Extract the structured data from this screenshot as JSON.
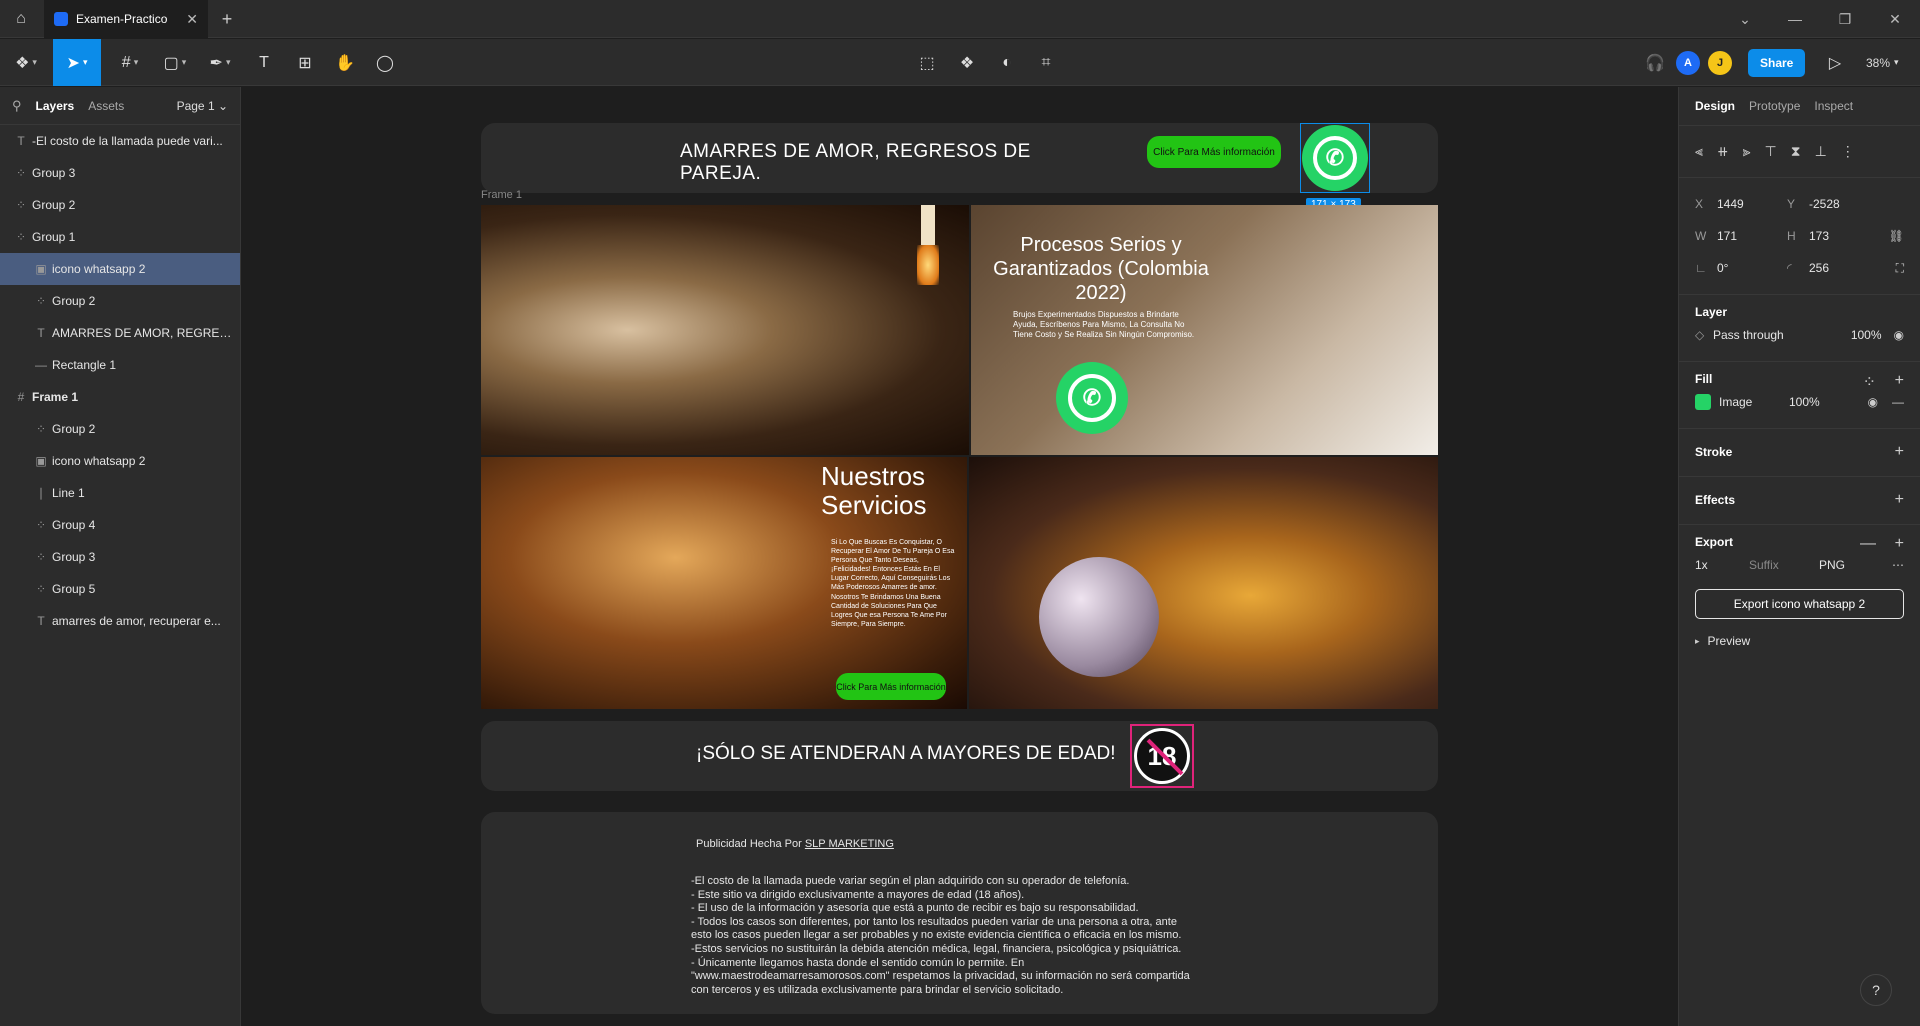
{
  "titlebar": {
    "tab_title": "Examen-Practico",
    "close_glyph": "✕",
    "new_tab_glyph": "+",
    "window_controls": [
      "⌄",
      "—",
      "❐",
      "✕"
    ]
  },
  "toolbar": {
    "avatars": [
      "A",
      "J"
    ],
    "share_label": "Share",
    "zoom": "38%"
  },
  "left_panel": {
    "tabs": {
      "layers": "Layers",
      "assets": "Assets"
    },
    "page": "Page 1 ⌄",
    "layers": [
      {
        "icon": "T",
        "name": "-El costo de la llamada puede vari..."
      },
      {
        "icon": "⁘",
        "name": "Group 3"
      },
      {
        "icon": "⁘",
        "name": "Group 2"
      },
      {
        "icon": "⁘",
        "name": "Group 1"
      },
      {
        "icon": "▣",
        "name": "icono whatsapp 2"
      },
      {
        "icon": "⁘",
        "name": "Group 2"
      },
      {
        "icon": "T",
        "name": "AMARRES DE AMOR, REGRES..."
      },
      {
        "icon": "—",
        "name": "Rectangle 1"
      },
      {
        "icon": "#",
        "name": "Frame 1"
      },
      {
        "icon": "⁘",
        "name": "Group 2"
      },
      {
        "icon": "▣",
        "name": "icono whatsapp 2"
      },
      {
        "icon": "∣",
        "name": "Line 1"
      },
      {
        "icon": "⁘",
        "name": "Group 4"
      },
      {
        "icon": "⁘",
        "name": "Group 3"
      },
      {
        "icon": "⁘",
        "name": "Group 5"
      },
      {
        "icon": "T",
        "name": "amarres de amor, recuperar e..."
      }
    ]
  },
  "canvas": {
    "header_title": "AMARRES DE AMOR, REGRESOS DE PAREJA.",
    "click_button": "Click Para Más información",
    "selection_size": "171 × 173",
    "frame_label": "Frame 1",
    "tile1_title": "Procesos Serios y Garantizados (Colombia 2022)",
    "tile1_text": "Brujos Experimentados Dispuestos a Brindarte Ayuda, Escríbenos Para Mismo, La Consulta No Tiene Costo y Se Realiza Sin Ningún Compromiso.",
    "tile3_title": "Nuestros Servicios",
    "tile3_text": "Si Lo Que Buscas Es Conquistar, O Recuperar El Amor De Tu Pareja O Esa Persona Que Tanto Deseas, ¡Felicidades! Entonces Estás En El Lugar Correcto, Aquí Conseguirás Los Más Poderosos Amarres de amor. Nosotros Te Brindamos Una Buena Cantidad de Soluciones Para Que Logres Que esa Persona Te Ame Por Siempre, Para Siempre.",
    "tile3_button": "Click Para Más información",
    "age_notice": "¡SÓLO SE ATENDERAN A MAYORES DE EDAD!",
    "age_badge": "18",
    "credit_prefix": "Publicidad Hecha Por ",
    "credit_link": "SLP MARKETING",
    "disclaimer": [
      "-El costo de la llamada puede variar según el plan adquirido con su operador de telefonía.",
      "- Este sitio va dirigido exclusivamente a mayores de edad (18 años).",
      "- El uso de la información y asesoría que está a punto de recibir es bajo su responsabilidad.",
      "- Todos los casos son diferentes, por tanto los resultados pueden variar de una persona a otra, ante",
      "esto los casos pueden llegar a ser probables y no existe evidencia científica o eficacia en los mismo.",
      "-Estos servicios no sustituirán la debida atención médica, legal, financiera, psicológica y psiquiátrica.",
      "- Únicamente llegamos hasta donde el sentido común lo permite. En",
      "\"www.maestrodeamarresamorosos.com\" respetamos la privacidad, su información no será compartida",
      "con terceros y es utilizada exclusivamente para brindar el servicio solicitado."
    ]
  },
  "right_panel": {
    "tabs": {
      "design": "Design",
      "prototype": "Prototype",
      "inspect": "Inspect"
    },
    "x_label": "X",
    "x": "1449",
    "y_label": "Y",
    "y": "-2528",
    "w_label": "W",
    "w": "171",
    "h_label": "H",
    "h": "173",
    "rotation": "0°",
    "radius": "256",
    "layer_title": "Layer",
    "blend": "Pass through",
    "layer_opacity": "100%",
    "fill_title": "Fill",
    "fill_type": "Image",
    "fill_opacity": "100%",
    "stroke_title": "Stroke",
    "effects_title": "Effects",
    "export_title": "Export",
    "export_scale": "1x",
    "export_suffix": "Suffix",
    "export_format": "PNG",
    "export_button": "Export icono whatsapp 2",
    "preview": "Preview"
  },
  "help": "?"
}
